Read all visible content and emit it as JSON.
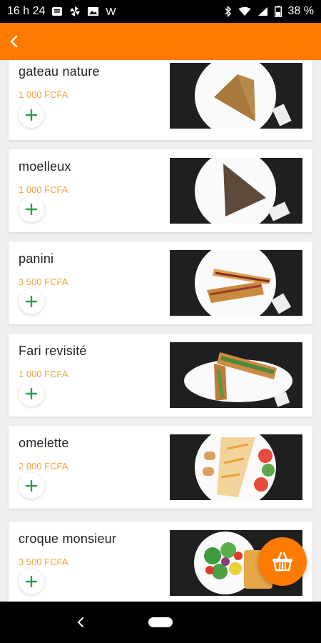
{
  "status_bar": {
    "time": "16 h 24",
    "notification_letter": "W",
    "battery": "38 %"
  },
  "app_bar": {
    "back_icon": "chevron-left-icon",
    "color": "#ff7a00"
  },
  "products": [
    {
      "name": "gateau nature",
      "price": "1 000 FCFA",
      "image": "triangle-cake-plate"
    },
    {
      "name": "moelleux",
      "price": "1 000 FCFA",
      "image": "chocolate-cake-plate"
    },
    {
      "name": "panini",
      "price": "3 500 FCFA",
      "image": "panini-plate"
    },
    {
      "name": "Fari revisité",
      "price": "1 000 FCFA",
      "image": "baguette-sandwich-plate"
    },
    {
      "name": "omelette",
      "price": "2 000 FCFA",
      "image": "omelette-plate"
    },
    {
      "name": "croque monsieur",
      "price": "3 500 FCFA",
      "image": "croque-salad-plate"
    }
  ],
  "colors": {
    "accent": "#ff7a00",
    "price": "#f0a23a",
    "add_icon": "#2e9e4a"
  },
  "fab": {
    "icon": "basket-icon"
  },
  "nav": {
    "back_icon": "nav-back-icon",
    "home_icon": "home-pill-icon"
  }
}
